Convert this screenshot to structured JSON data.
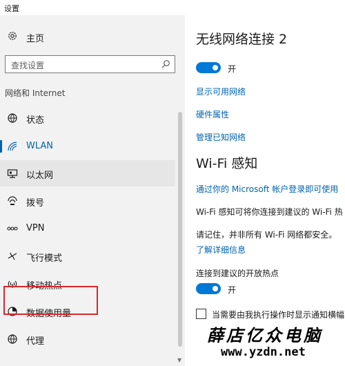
{
  "window": {
    "title": "设置"
  },
  "sidebar": {
    "home_label": "主页",
    "search_placeholder": "查找设置",
    "section_title": "网络和 Internet",
    "items": [
      {
        "label": "状态",
        "icon": "globe-status-icon"
      },
      {
        "label": "WLAN",
        "icon": "wifi-icon",
        "active": true
      },
      {
        "label": "以太网",
        "icon": "ethernet-icon"
      },
      {
        "label": "拨号",
        "icon": "dialup-icon"
      },
      {
        "label": "VPN",
        "icon": "vpn-icon"
      },
      {
        "label": "飞行模式",
        "icon": "airplane-icon"
      },
      {
        "label": "移动热点",
        "icon": "hotspot-icon",
        "highlighted": true
      },
      {
        "label": "数据使用量",
        "icon": "data-usage-icon"
      },
      {
        "label": "代理",
        "icon": "globe-icon"
      }
    ]
  },
  "main": {
    "title": "无线网络连接 2",
    "wifi_toggle_label": "开",
    "links": {
      "show_networks": "显示可用网络",
      "hardware_props": "硬件属性",
      "manage_known": "管理已知网络"
    },
    "wifi_sense_title": "Wi-Fi 感知",
    "wifi_sense_link": "通过你的 Microsoft 帐户登录即可使用",
    "wifi_sense_desc": "Wi-Fi 感知可将你连接到建议的 Wi-Fi 热",
    "remember_text": "请记住，并非所有 Wi-Fi 网络都安全。",
    "learn_more": "了解详细信息",
    "open_hotspots_label": "连接到建议的开放热点",
    "open_hotspots_toggle_label": "开",
    "notify_checkbox_label": "当需要由我执行操作时显示通知横幅"
  },
  "watermark": {
    "brand": "薛店亿众电脑",
    "url": "www.yzdn.net"
  },
  "colors": {
    "accent": "#0078d7",
    "link": "#0063b1",
    "highlight": "#d9252a",
    "sidebar_bg": "#f2f2f2"
  }
}
